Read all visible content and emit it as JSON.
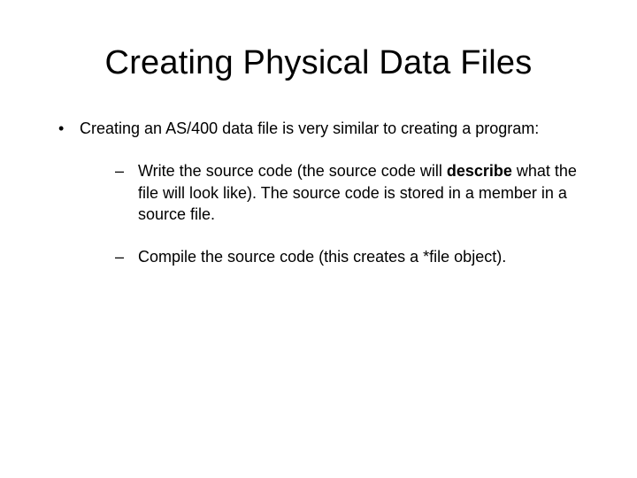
{
  "title": "Creating Physical Data Files",
  "bullet_lead": "Creating an AS/400 data file is very similar to creating a program:",
  "sub1_pre": "Write the source code (the source code will ",
  "sub1_bold": "describe",
  "sub1_post": " what the file will look like). The source code is stored in a member in a source file.",
  "sub2": "Compile the source code (this creates a *file object)."
}
